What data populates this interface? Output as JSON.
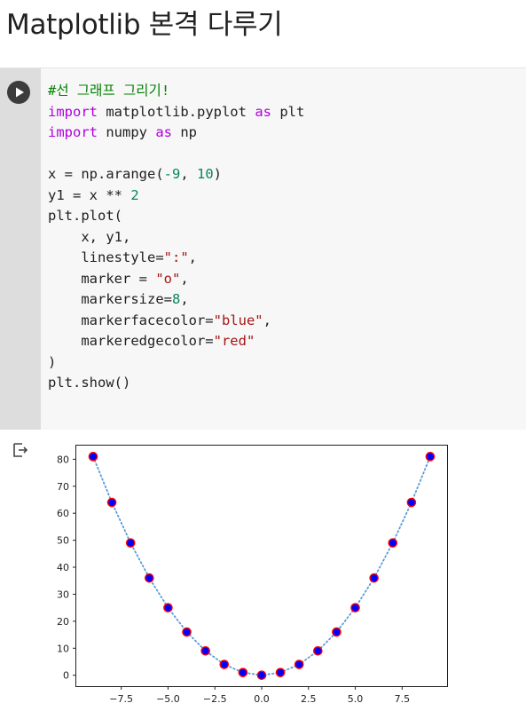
{
  "title": "Matplotlib 본격 다루기",
  "cell": {
    "run_button": "run-cell",
    "code_lines": [
      [
        {
          "t": "#선 그래프 그리기!",
          "c": "comment"
        }
      ],
      [
        {
          "t": "import",
          "c": "kw"
        },
        {
          "t": " matplotlib.pyplot ",
          "c": "plain"
        },
        {
          "t": "as",
          "c": "kw"
        },
        {
          "t": " plt",
          "c": "plain"
        }
      ],
      [
        {
          "t": "import",
          "c": "kw"
        },
        {
          "t": " numpy ",
          "c": "plain"
        },
        {
          "t": "as",
          "c": "kw"
        },
        {
          "t": " np",
          "c": "plain"
        }
      ],
      [],
      [
        {
          "t": "x = np.arange(",
          "c": "plain"
        },
        {
          "t": "-9",
          "c": "num"
        },
        {
          "t": ", ",
          "c": "plain"
        },
        {
          "t": "10",
          "c": "num"
        },
        {
          "t": ")",
          "c": "plain"
        }
      ],
      [
        {
          "t": "y1 = x ** ",
          "c": "plain"
        },
        {
          "t": "2",
          "c": "num"
        }
      ],
      [
        {
          "t": "plt.plot(",
          "c": "plain"
        }
      ],
      [
        {
          "t": "    x, y1,",
          "c": "plain"
        }
      ],
      [
        {
          "t": "    linestyle=",
          "c": "plain"
        },
        {
          "t": "\":\"",
          "c": "str"
        },
        {
          "t": ",",
          "c": "plain"
        }
      ],
      [
        {
          "t": "    marker = ",
          "c": "plain"
        },
        {
          "t": "\"o\"",
          "c": "str"
        },
        {
          "t": ",",
          "c": "plain"
        }
      ],
      [
        {
          "t": "    markersize=",
          "c": "plain"
        },
        {
          "t": "8",
          "c": "num"
        },
        {
          "t": ",",
          "c": "plain"
        }
      ],
      [
        {
          "t": "    markerfacecolor=",
          "c": "plain"
        },
        {
          "t": "\"blue\"",
          "c": "str"
        },
        {
          "t": ",",
          "c": "plain"
        }
      ],
      [
        {
          "t": "    markeredgecolor=",
          "c": "plain"
        },
        {
          "t": "\"red\"",
          "c": "str"
        }
      ],
      [
        {
          "t": ")",
          "c": "plain"
        }
      ],
      [
        {
          "t": "plt.show()",
          "c": "plain"
        }
      ]
    ]
  },
  "output": {
    "icon": "output-arrow-icon"
  },
  "chart_data": {
    "type": "line",
    "title": "",
    "xlabel": "",
    "ylabel": "",
    "x": [
      -9,
      -8,
      -7,
      -6,
      -5,
      -4,
      -3,
      -2,
      -1,
      0,
      1,
      2,
      3,
      4,
      5,
      6,
      7,
      8,
      9
    ],
    "series": [
      {
        "values": [
          81,
          64,
          49,
          36,
          25,
          16,
          9,
          4,
          1,
          0,
          1,
          4,
          9,
          16,
          25,
          36,
          49,
          64,
          81
        ],
        "line_color": "#5b9bd5",
        "linestyle": "dotted",
        "marker": "circle",
        "marker_face": "#0000ff",
        "marker_edge": "#ff0000"
      }
    ],
    "xticks": [
      "−7.5",
      "−5.0",
      "−2.5",
      "0.0",
      "2.5",
      "5.0",
      "7.5"
    ],
    "xtick_values": [
      -7.5,
      -5.0,
      -2.5,
      0.0,
      2.5,
      5.0,
      7.5
    ],
    "yticks": [
      "0",
      "10",
      "20",
      "30",
      "40",
      "50",
      "60",
      "70",
      "80"
    ],
    "ytick_values": [
      0,
      10,
      20,
      30,
      40,
      50,
      60,
      70,
      80
    ],
    "xlim": [
      -9.9,
      9.9
    ],
    "ylim": [
      -4.05,
      85.05
    ],
    "grid": false,
    "legend": "none"
  }
}
